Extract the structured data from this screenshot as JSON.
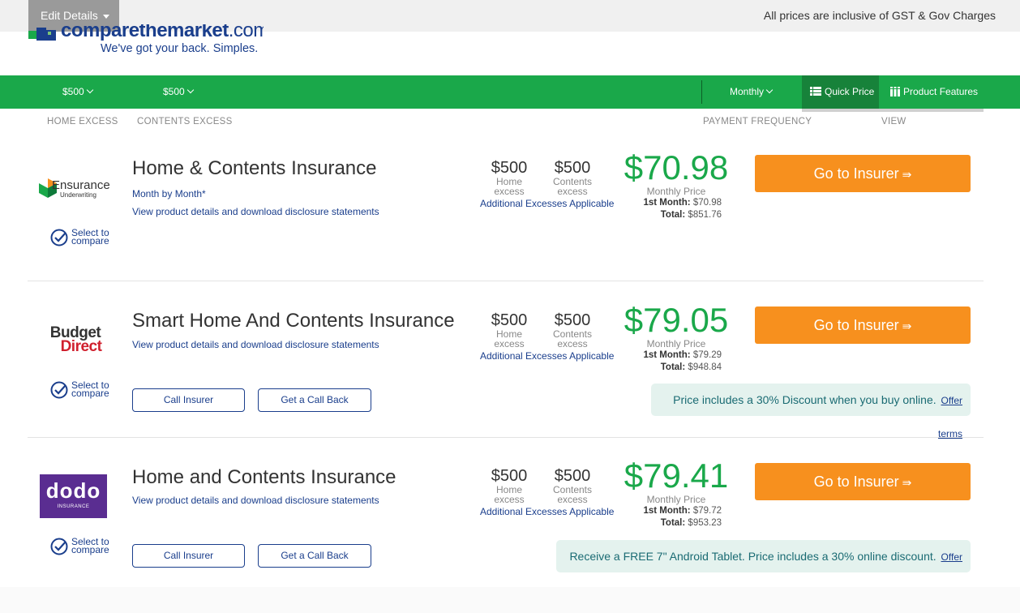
{
  "topbar": {
    "edit_details": "Edit Details",
    "gst_note": "All prices are inclusive of GST & Gov Charges"
  },
  "logo": {
    "wordmark": "comparethemarket",
    "tld": ".com.au",
    "tagline": "We've got your back. Simples."
  },
  "filters": {
    "home_excess_value": "$500",
    "home_excess_label": "HOME EXCESS",
    "contents_excess_value": "$500",
    "contents_excess_label": "CONTENTS EXCESS",
    "payment_frequency_value": "Monthly",
    "payment_frequency_label": "PAYMENT FREQUENCY",
    "view_label": "VIEW",
    "view_quick_price": "Quick Price",
    "view_product_features": "Product Features"
  },
  "common": {
    "select_to": "Select to",
    "compare": "compare",
    "home": "Home",
    "contents": "Contents",
    "excess": "excess",
    "additional_excesses": "Additional Excesses Applicable",
    "monthly_price": "Monthly Price",
    "first_month": "1st Month:",
    "total": "Total:",
    "go_to_insurer": "Go to Insurer",
    "call_insurer": "Call Insurer",
    "get_call_back": "Get a Call Back",
    "offer_terms": "Offer terms",
    "view_details": "View product details and download disclosure statements"
  },
  "results": [
    {
      "insurer": "Ensurance",
      "insurer_sub": "Underwriting",
      "title": "Home & Contents Insurance",
      "payment_note": "Month by Month*",
      "home_excess": "$500",
      "contents_excess": "$500",
      "price": "$70.98",
      "first_month_value": "$70.98",
      "total_value": "$851.76"
    },
    {
      "insurer": "Budget Direct",
      "insurer_line1": "Budget",
      "insurer_line2": "Direct",
      "title": "Smart Home And Contents Insurance",
      "home_excess": "$500",
      "contents_excess": "$500",
      "price": "$79.05",
      "first_month_value": "$79.29",
      "total_value": "$948.84",
      "offer": "Price includes a 30% Discount when you buy online."
    },
    {
      "insurer": "dodo",
      "insurer_sub": "INSURANCE",
      "title": "Home and Contents Insurance",
      "home_excess": "$500",
      "contents_excess": "$500",
      "price": "$79.41",
      "first_month_value": "$79.72",
      "total_value": "$953.23",
      "offer": "Receive a FREE 7\" Android Tablet. Price includes a 30% online discount."
    }
  ],
  "colors": {
    "brand_green": "#1aa84a",
    "brand_blue": "#1a3e8c",
    "cta_orange": "#f7901e",
    "offer_bg": "#e4f2ee"
  }
}
